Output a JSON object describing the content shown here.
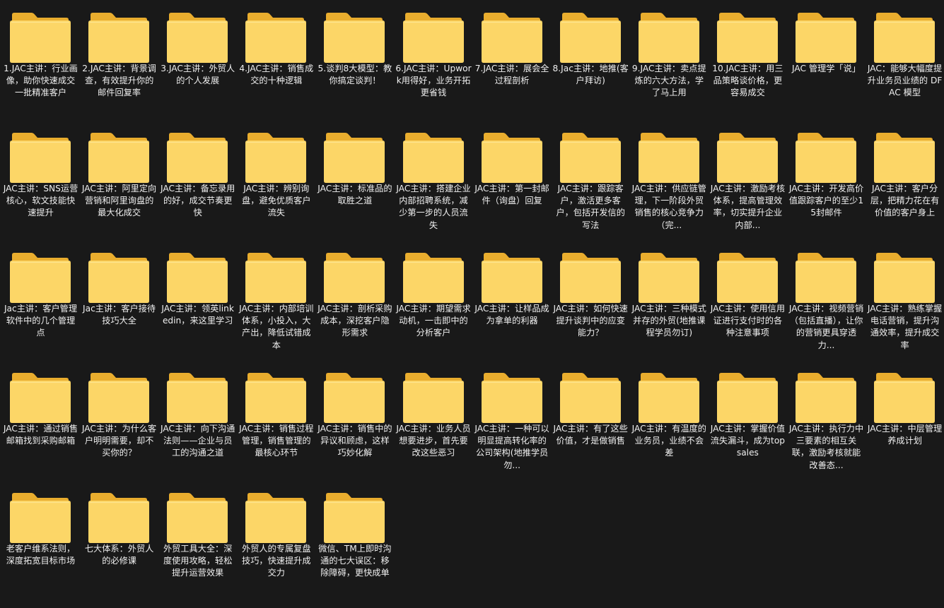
{
  "view": {
    "background": "#191919",
    "icon_name": "folder-icon",
    "folder_colors": {
      "back": "#e9ad2e",
      "front": "#fcd667",
      "highlight": "#fde58f"
    }
  },
  "folders": [
    {
      "name": "1.JAC主讲：行业画像，助你快速成交一批精准客户"
    },
    {
      "name": "2.JAC主讲：背景调查，有效提升你的邮件回复率"
    },
    {
      "name": "3.JAC主讲：外贸人的个人发展"
    },
    {
      "name": "4.JAC主讲：销售成交的十种逻辑"
    },
    {
      "name": "5.谈判8大模型：教你搞定谈判！"
    },
    {
      "name": "6.JAC主讲：Upwork用得好，业务开拓更省钱"
    },
    {
      "name": "7.JAC主讲：展会全过程剖析"
    },
    {
      "name": "8.Jac主讲：地推(客户拜访)"
    },
    {
      "name": "9.JAC主讲：卖点提炼的六大方法，学了马上用"
    },
    {
      "name": "10.JAC主讲：用三品策略谈价格，更容易成交"
    },
    {
      "name": "JAC 管理学「说」"
    },
    {
      "name": "JAC：能够大幅度提升业务员业绩的 DFAC 模型"
    },
    {
      "name": "JAC主讲：SNS运营核心，软文技能快速提升"
    },
    {
      "name": "JAC主讲：阿里定向营销和阿里询盘的最大化成交"
    },
    {
      "name": "JAC主讲：备忘录用的好，成交节奏更快"
    },
    {
      "name": "JAC主讲：辨别询盘，避免优质客户流失"
    },
    {
      "name": "JAC主讲：标准品的取胜之道"
    },
    {
      "name": "JAC主讲：搭建企业内部招聘系统，减少第一步的人员流失"
    },
    {
      "name": "JAC主讲：第一封邮件（询盘）回复"
    },
    {
      "name": "JAC主讲：跟踪客户，激活更多客户，包括开发信的写法"
    },
    {
      "name": "JAC主讲：供应链管理，下一阶段外贸销售的核心竞争力（完..."
    },
    {
      "name": "JAC主讲：激励考核体系，提高管理效率，切实提升企业内部..."
    },
    {
      "name": "JAC主讲：开发高价值跟踪客户的至少15封邮件"
    },
    {
      "name": "JAC主讲：客户分层，把精力花在有价值的客户身上"
    },
    {
      "name": "Jac主讲：客户管理软件中的几个管理点"
    },
    {
      "name": "Jac主讲：客户接待技巧大全"
    },
    {
      "name": "JAC主讲：领英linkedin，来这里学习"
    },
    {
      "name": "JAC主讲：内部培训体系，小投入，大产出，降低试错成本"
    },
    {
      "name": "JAC主讲：剖析采购成本，深挖客户隐形需求"
    },
    {
      "name": "JAC主讲：期望需求动机，一击即中的分析客户"
    },
    {
      "name": "JAC主讲：让样品成为拿单的利器"
    },
    {
      "name": "JAC主讲：如何快速提升谈判中的应变能力？"
    },
    {
      "name": "JAC主讲：三种模式并存的外贸(地推课程学员勿订)"
    },
    {
      "name": "JAC主讲：使用信用证进行支付时的各种注意事项"
    },
    {
      "name": "JAC主讲：视频营销（包括直播），让你的营销更具穿透力..."
    },
    {
      "name": "JAC主讲：熟练掌握电话营销，提升沟通效率，提升成交率"
    },
    {
      "name": "JAC主讲：通过销售邮箱找到采购邮箱"
    },
    {
      "name": "JAC主讲：为什么客户明明需要，却不买你的？"
    },
    {
      "name": "JAC主讲：向下沟通法则——企业与员工的沟通之道"
    },
    {
      "name": "JAC主讲：销售过程管理，销售管理的最核心环节"
    },
    {
      "name": "JAC主讲：销售中的异议和顾虑，这样巧妙化解"
    },
    {
      "name": "JAC主讲：业务人员想要进步，首先要改这些恶习"
    },
    {
      "name": "JAC主讲：一种可以明显提高转化率的公司架构(地推学员勿..."
    },
    {
      "name": "JAC主讲：有了这些价值，才是做销售"
    },
    {
      "name": "JAC主讲：有温度的业务员，业绩不会差"
    },
    {
      "name": "JAC主讲：掌握价值流失漏斗，成为topsales"
    },
    {
      "name": "JAC主讲：执行力中三要素的相互关联，激励考核就能改善态..."
    },
    {
      "name": "JAC主讲：中层管理养成计划"
    },
    {
      "name": "老客户维系法则，深度拓宽目标市场"
    },
    {
      "name": "七大体系：外贸人的必修课"
    },
    {
      "name": "外贸工具大全：深度使用攻略，轻松提升运营效果"
    },
    {
      "name": "外贸人的专属复盘技巧，快速提升成交力"
    },
    {
      "name": "微信、TM上即时沟通的七大误区：移除障碍，更快成单"
    }
  ]
}
